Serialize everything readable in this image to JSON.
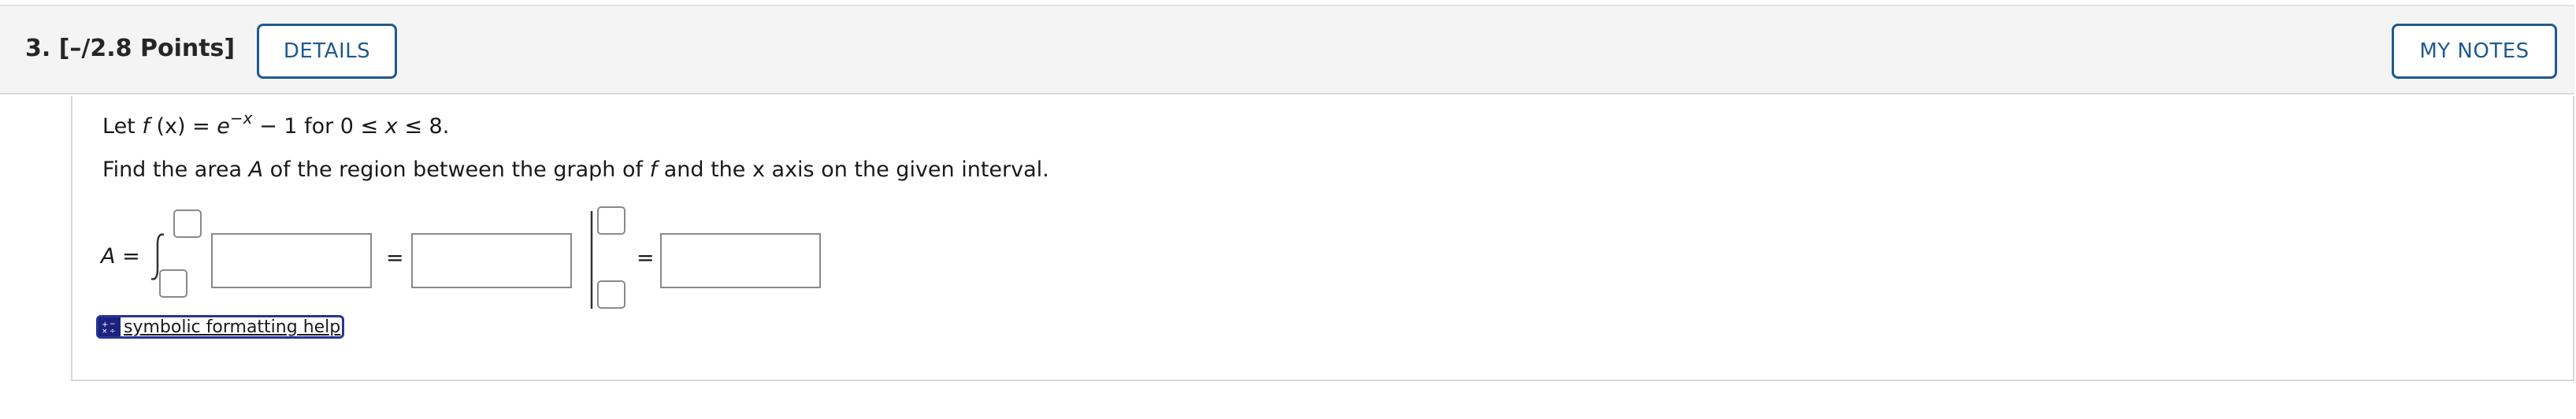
{
  "question": {
    "number_points": "3.  [–/2.8 Points]",
    "details_label": "DETAILS",
    "my_notes_label": "MY NOTES"
  },
  "problem": {
    "line1_prefix": "Let ",
    "line1_f": "f",
    "line1_mid": " (x) = ",
    "line1_e": "e",
    "line1_exp": "−x",
    "line1_rest": " − 1 for 0 ≤ ",
    "line1_x": "x",
    "line1_end": " ≤ 8.",
    "line2_a": "Find the area ",
    "line2_A": "A",
    "line2_b": " of the region between the graph of ",
    "line2_f": "f",
    "line2_c": " and the x axis on the given interval."
  },
  "answer": {
    "lhs_var": "A",
    "lhs_eq": " =",
    "eq1": "=",
    "eq2": "="
  },
  "help": {
    "label": "symbolic formatting help"
  },
  "colors": {
    "accent": "#1f5a8f",
    "help_icon": "#1a237e",
    "header_bg": "#f4f4f4"
  }
}
